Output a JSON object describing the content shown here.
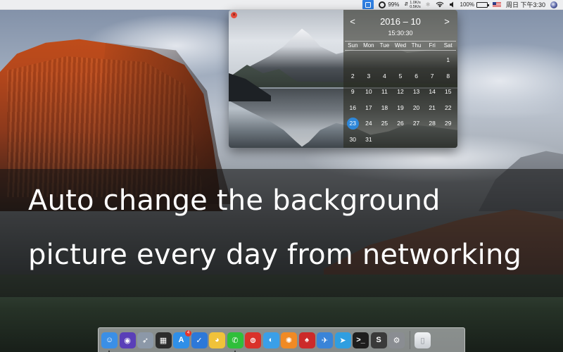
{
  "menubar": {
    "battery_percent_small": "99%",
    "net_up": "1.0K/s",
    "net_down": "0.5K/s",
    "battery_percent": "100%",
    "clock": "周日 下午3:30",
    "icons": [
      "calendar-app-icon",
      "ring-icon",
      "transfer-arrows-icon",
      "bluetooth-icon",
      "wifi-icon",
      "volume-icon",
      "battery-icon",
      "us-flag-icon",
      "user-avatar-icon"
    ]
  },
  "calendar": {
    "month_label": "2016 – 10",
    "time": "15:30:30",
    "prev_symbol": "<",
    "next_symbol": ">",
    "close_symbol": "×",
    "weekdays": [
      "Sun",
      "Mon",
      "Tue",
      "Wed",
      "Thu",
      "Fri",
      "Sat"
    ],
    "weeks": [
      [
        "",
        "",
        "",
        "",
        "",
        "",
        "1"
      ],
      [
        "2",
        "3",
        "4",
        "5",
        "6",
        "7",
        "8"
      ],
      [
        "9",
        "10",
        "11",
        "12",
        "13",
        "14",
        "15"
      ],
      [
        "16",
        "17",
        "18",
        "19",
        "20",
        "21",
        "22"
      ],
      [
        "23",
        "24",
        "25",
        "26",
        "27",
        "28",
        "29"
      ],
      [
        "30",
        "31",
        "",
        "",
        "",
        "",
        ""
      ]
    ],
    "today": "23",
    "today_color": "#2e87d9"
  },
  "banner": {
    "line1": "Auto change the background",
    "line2": "picture every day from networking"
  },
  "dock": {
    "apps": [
      {
        "name": "finder",
        "glyph": "☺",
        "color": "#3b8fe6",
        "running": true
      },
      {
        "name": "siri",
        "glyph": "◉",
        "color": "#5a3fb8",
        "running": false
      },
      {
        "name": "launchpad",
        "glyph": "➶",
        "color": "#8c98a8",
        "running": false
      },
      {
        "name": "mission-control",
        "glyph": "▦",
        "color": "#2c2c2c",
        "running": false
      },
      {
        "name": "app-store",
        "glyph": "A",
        "color": "#2f8fe8",
        "running": false,
        "badge": "4"
      },
      {
        "name": "security",
        "glyph": "✓",
        "color": "#2d78d8",
        "running": false
      },
      {
        "name": "qq",
        "glyph": "◕",
        "color": "#f0c23a",
        "running": false
      },
      {
        "name": "wechat",
        "glyph": "✆",
        "color": "#2fbf3a",
        "running": true
      },
      {
        "name": "netease-music",
        "glyph": "⊚",
        "color": "#d9322a",
        "running": false
      },
      {
        "name": "qq-browser",
        "glyph": "◐",
        "color": "#3a9fe8",
        "running": false
      },
      {
        "name": "uc-browser",
        "glyph": "✺",
        "color": "#f08a24",
        "running": false
      },
      {
        "name": "card-game",
        "glyph": "♠",
        "color": "#cc2a2a",
        "running": false
      },
      {
        "name": "xcode-bird",
        "glyph": "✈",
        "color": "#3a84d8",
        "running": false
      },
      {
        "name": "telegram",
        "glyph": "➤",
        "color": "#2f9ee0",
        "running": false
      },
      {
        "name": "terminal",
        "glyph": ">_",
        "color": "#1e1e1e",
        "running": false
      },
      {
        "name": "sublime-text",
        "glyph": "S",
        "color": "#3a3a3a",
        "running": false
      },
      {
        "name": "system-preferences",
        "glyph": "⚙",
        "color": "#8a8d92",
        "running": false
      }
    ],
    "trash": {
      "name": "trash",
      "glyph": "▯",
      "color": "#cfd3d8"
    }
  },
  "colors": {
    "banner_overlay": "rgba(20,20,20,0.58)",
    "close_button": "#e64b3c",
    "menubar_accent": "#2f7fe2"
  }
}
